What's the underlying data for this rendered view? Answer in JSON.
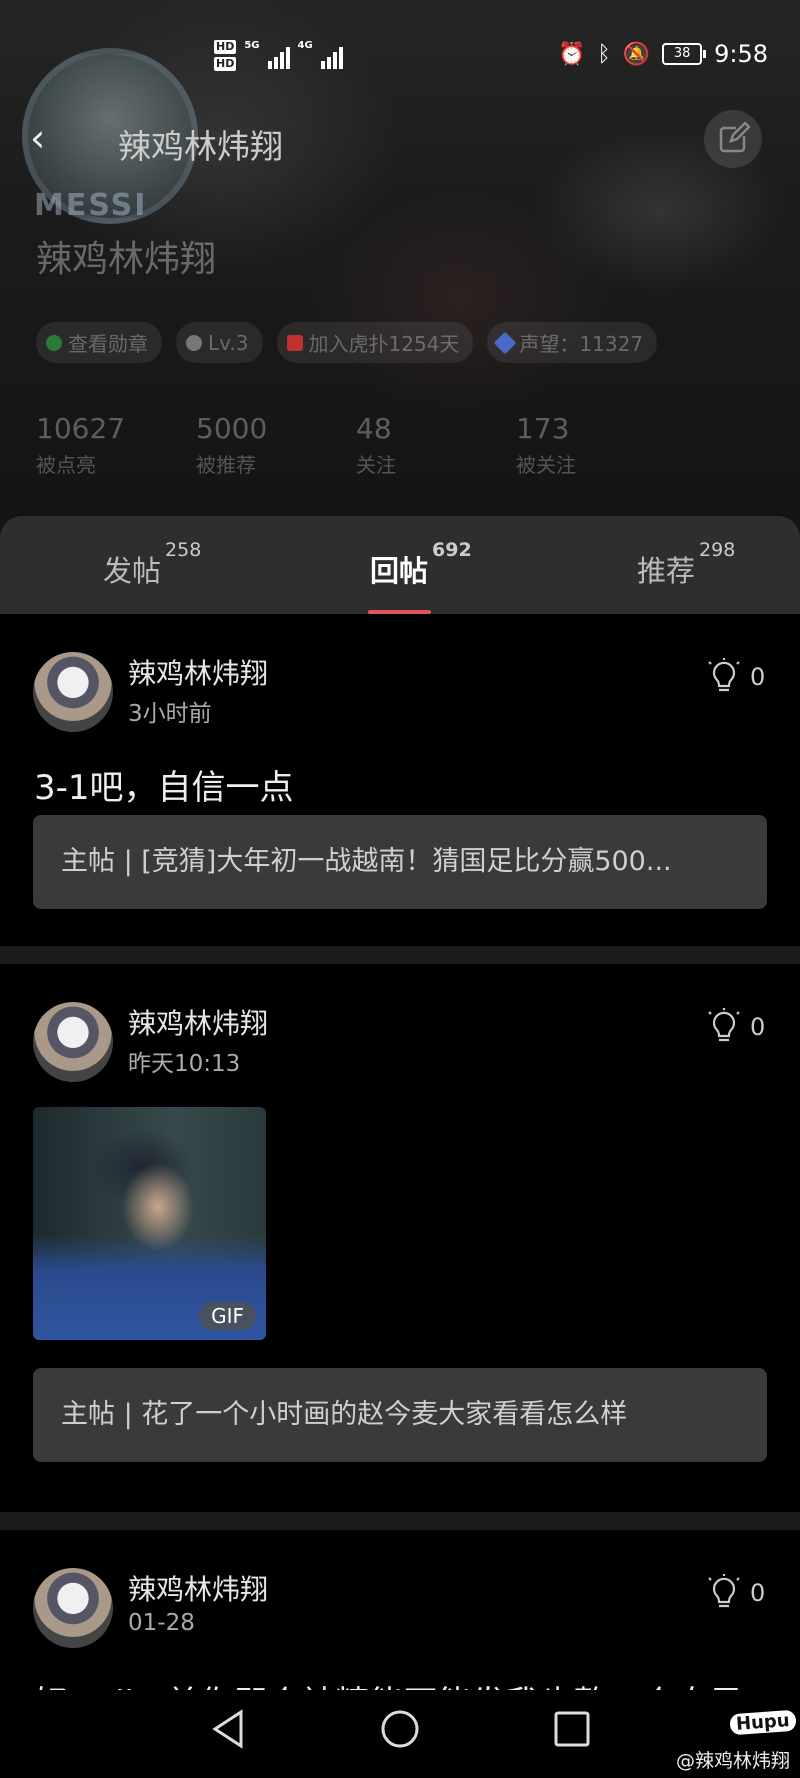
{
  "status_bar": {
    "time": "9:58",
    "battery": "38",
    "hd1": "HD",
    "hd2": "HD",
    "net1": "5G",
    "net2": "4G"
  },
  "header": {
    "title": "辣鸡林炜翔",
    "avatar_text": "MESSI"
  },
  "profile": {
    "name": "辣鸡林炜翔",
    "badges": [
      {
        "label": "查看勋章",
        "color": "#2a7a3a"
      },
      {
        "label": "Lv.3",
        "color": "#777777"
      },
      {
        "label": "加入虎扑1254天",
        "color": "#c03030"
      },
      {
        "label": "声望：11327",
        "color": "#4a6ac8"
      }
    ],
    "stats": [
      {
        "value": "10627",
        "label": "被点亮"
      },
      {
        "value": "5000",
        "label": "被推荐"
      },
      {
        "value": "48",
        "label": "关注"
      },
      {
        "value": "173",
        "label": "被关注"
      }
    ]
  },
  "tabs": [
    {
      "label": "发帖",
      "count": "258"
    },
    {
      "label": "回帖",
      "count": "692"
    },
    {
      "label": "推荐",
      "count": "298"
    }
  ],
  "posts": [
    {
      "user": "辣鸡林炜翔",
      "time": "3小时前",
      "likes": "0",
      "content": "3-1吧，自信一点",
      "quote": "主帖 | [竞猜]大年初一战越南！猜国足比分赢500..."
    },
    {
      "user": "辣鸡林炜翔",
      "time": "昨天10:13",
      "likes": "0",
      "gif_label": "GIF",
      "quote": "主帖 | 花了一个小时画的赵今麦大家看看怎么样"
    },
    {
      "user": "辣鸡林炜翔",
      "time": "01-28",
      "likes": "0",
      "content": "好radio 单你即个神精能不能发我也整一个自己"
    }
  ],
  "watermark": {
    "logo": "Hupu",
    "text": "@辣鸡林炜翔"
  }
}
